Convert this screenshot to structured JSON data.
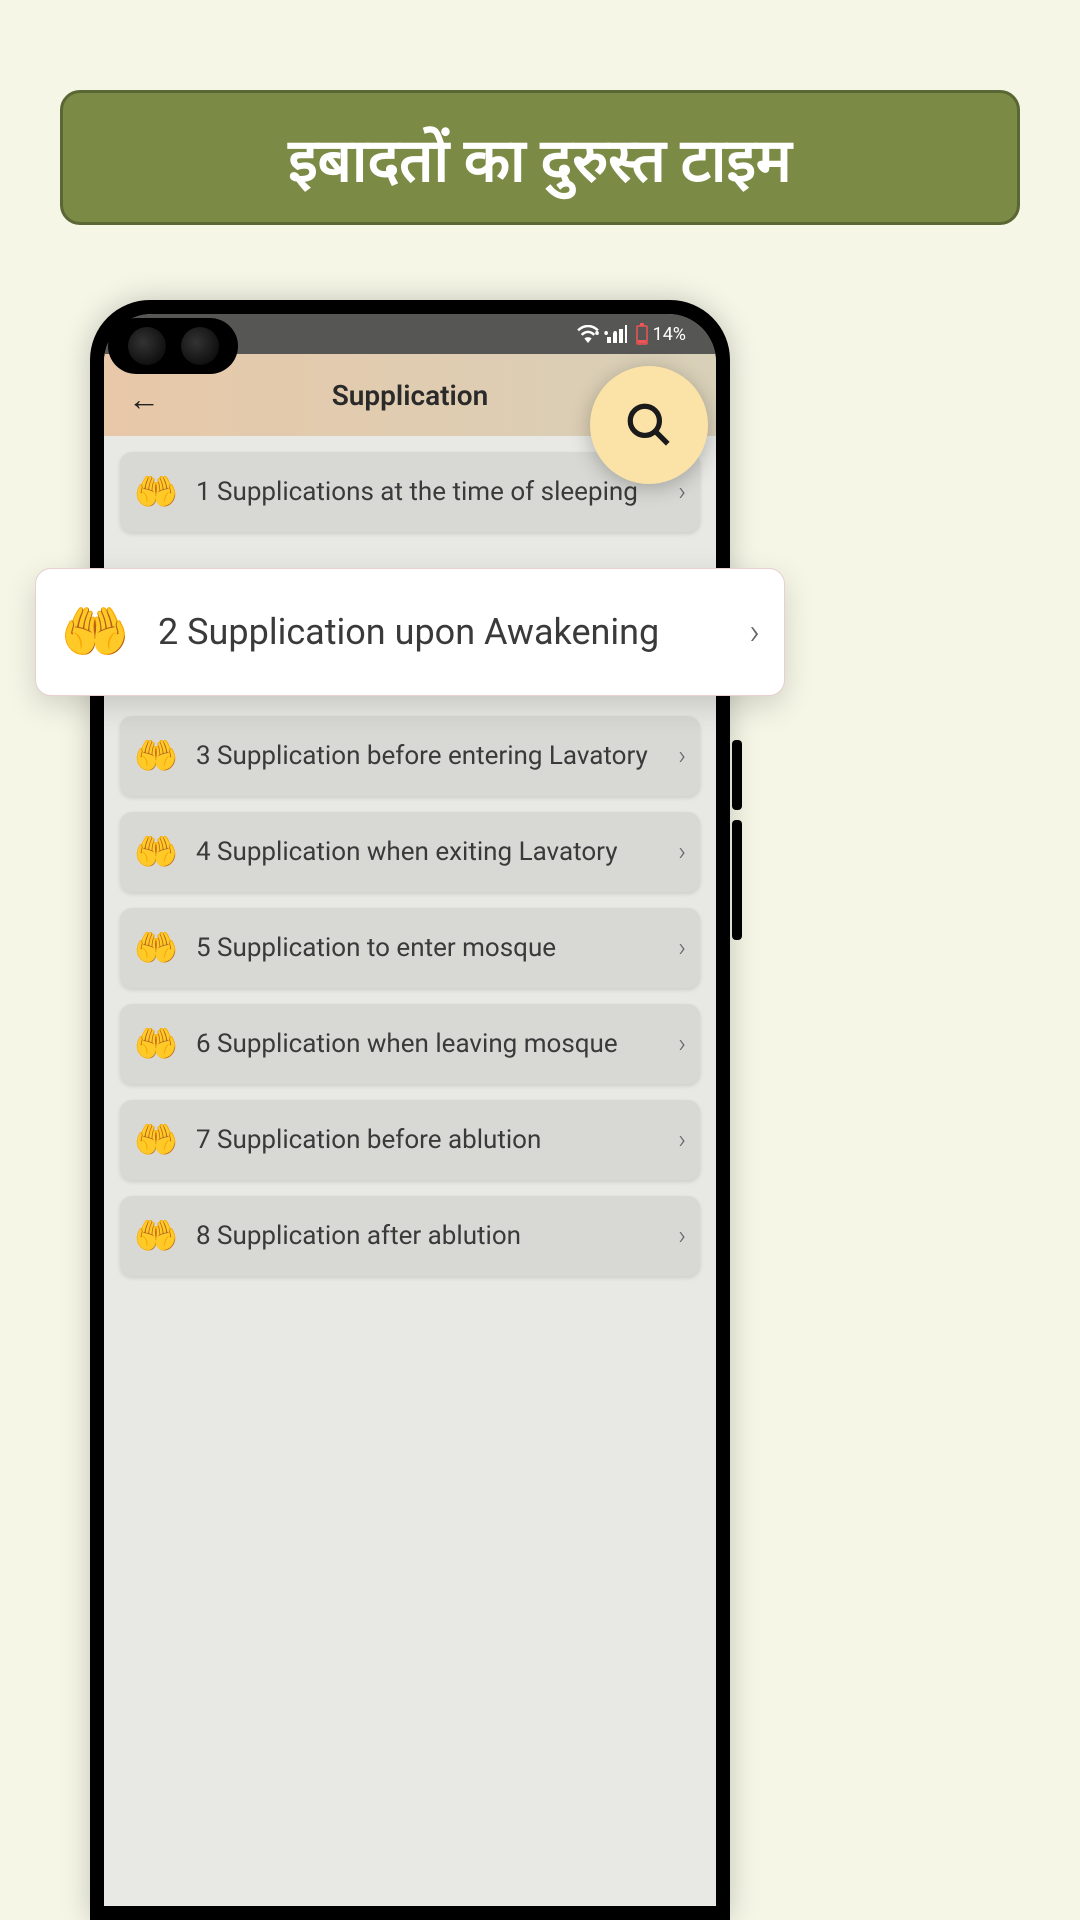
{
  "banner": {
    "title": "इबादतों का दुरुस्त टाइम"
  },
  "status": {
    "dots": "•••",
    "battery": "14%"
  },
  "header": {
    "title": "Supplication",
    "back_icon": "←"
  },
  "items": [
    {
      "num": "1",
      "label": "Supplications at the time of sleeping"
    },
    {
      "num": "2",
      "label": "Supplication upon Awakening"
    },
    {
      "num": "3",
      "label": "Supplication before entering Lavatory"
    },
    {
      "num": "4",
      "label": "Supplication when exiting Lavatory"
    },
    {
      "num": "5",
      "label": "Supplication to enter mosque"
    },
    {
      "num": "6",
      "label": "Supplication when leaving mosque"
    },
    {
      "num": "7",
      "label": "Supplication before ablution"
    },
    {
      "num": "8",
      "label": "Supplication after ablution"
    }
  ],
  "highlighted_index": 1
}
